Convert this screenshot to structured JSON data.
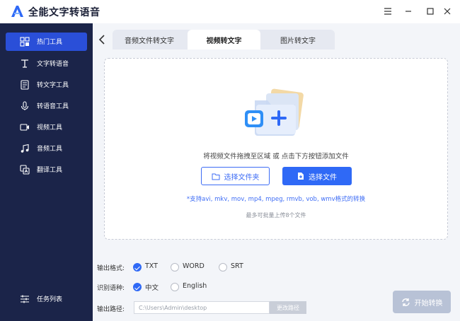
{
  "app": {
    "title": "全能文字转语音",
    "brand_color": "#2f69f6"
  },
  "window_controls": [
    "menu-icon",
    "minimize-icon",
    "maximize-icon",
    "close-icon"
  ],
  "sidebar": {
    "items": [
      {
        "label": "热门工具",
        "icon": "hot-tools-icon",
        "active": true
      },
      {
        "label": "文字转语音",
        "icon": "text-to-speech-icon",
        "active": false
      },
      {
        "label": "转文字工具",
        "icon": "to-text-icon",
        "active": false
      },
      {
        "label": "转语音工具",
        "icon": "to-speech-icon",
        "active": false
      },
      {
        "label": "视频工具",
        "icon": "video-tools-icon",
        "active": false
      },
      {
        "label": "音频工具",
        "icon": "audio-tools-icon",
        "active": false
      },
      {
        "label": "翻译工具",
        "icon": "translate-tools-icon",
        "active": false
      }
    ],
    "task_list_label": "任务列表"
  },
  "tabs": [
    {
      "label": "音频文件转文字",
      "active": false
    },
    {
      "label": "视频转文字",
      "active": true
    },
    {
      "label": "图片转文字",
      "active": false
    }
  ],
  "dropzone": {
    "hint": "将视频文件拖拽至区域 或 点击下方按钮添加文件",
    "select_folder_label": "选择文件夹",
    "select_file_label": "选择文件",
    "supported_formats": "*支持avi, mkv, mov, mp4, mpeg, rmvb, vob, wmv格式的转换",
    "max_files": "最多可批量上传8个文件"
  },
  "options": {
    "format": {
      "label": "输出格式:",
      "choices": [
        "TXT",
        "WORD",
        "SRT"
      ],
      "selected": "TXT"
    },
    "language": {
      "label": "识别语种:",
      "choices": [
        "中文",
        "English"
      ],
      "selected": "中文"
    },
    "path": {
      "label": "输出路径:",
      "value": "C:\\Users\\Admin\\desktop",
      "change_label": "更改路径"
    }
  },
  "start_button_label": "开始转换"
}
